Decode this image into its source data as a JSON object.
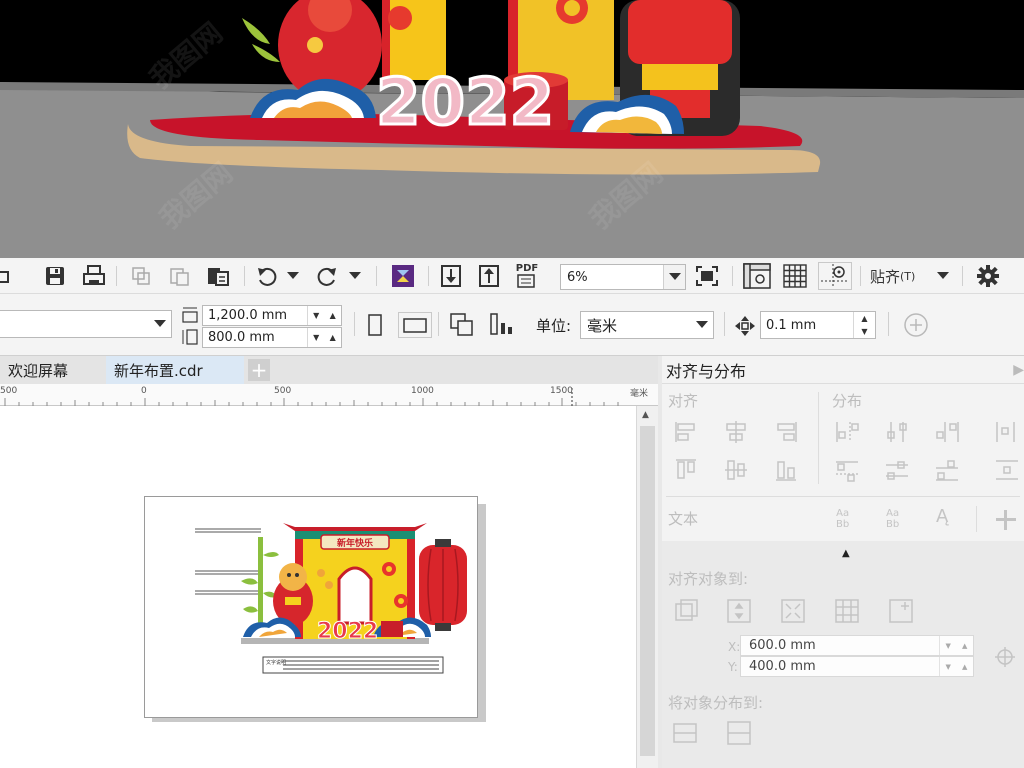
{
  "render_scene": {
    "year_text": "2022"
  },
  "toolbar": {
    "zoom_value": "6%",
    "pdf_label": "PDF",
    "snap_label": "贴齐",
    "snap_suffix": "(T)",
    "icons": [
      "save-icon",
      "print-icon",
      "copy-icon",
      "paste-icon",
      "clipboard-icon",
      "undo-icon",
      "redo-icon",
      "corel-connect-icon",
      "import-icon",
      "export-icon",
      "pdf-icon",
      "fullscreen-icon",
      "rulers-icon",
      "grid-icon",
      "guidelines-icon",
      "gear-icon"
    ]
  },
  "property_bar": {
    "page_size_value": "",
    "width_value": "1,200.0 mm",
    "height_value": "800.0 mm",
    "units_label": "单位:",
    "units_value": "毫米",
    "nudge_value": "0.1 mm"
  },
  "tabs": [
    {
      "label": "欢迎屏幕"
    },
    {
      "label": "新年布置.cdr"
    }
  ],
  "ruler": {
    "ticks": [
      "500",
      "0",
      "500",
      "1000",
      "1500"
    ],
    "unit": "毫米"
  },
  "artboard": {
    "banner_text": "新年快乐",
    "year_text": "2022",
    "note_label": "文字说明"
  },
  "docker": {
    "title": "对齐与分布",
    "section_align": "对齐",
    "section_distribute": "分布",
    "section_text": "文本",
    "section_align_to": "对齐对象到:",
    "x_label": "X:",
    "x_value": "600.0 mm",
    "y_label": "Y:",
    "y_value": "400.0 mm",
    "section_distribute_to": "将对象分布到:"
  },
  "colors": {
    "accent_red": "#d91f26",
    "accent_yellow": "#f7d117",
    "accent_blue": "#1f78c8",
    "tab_active": "#dbe8f5"
  }
}
